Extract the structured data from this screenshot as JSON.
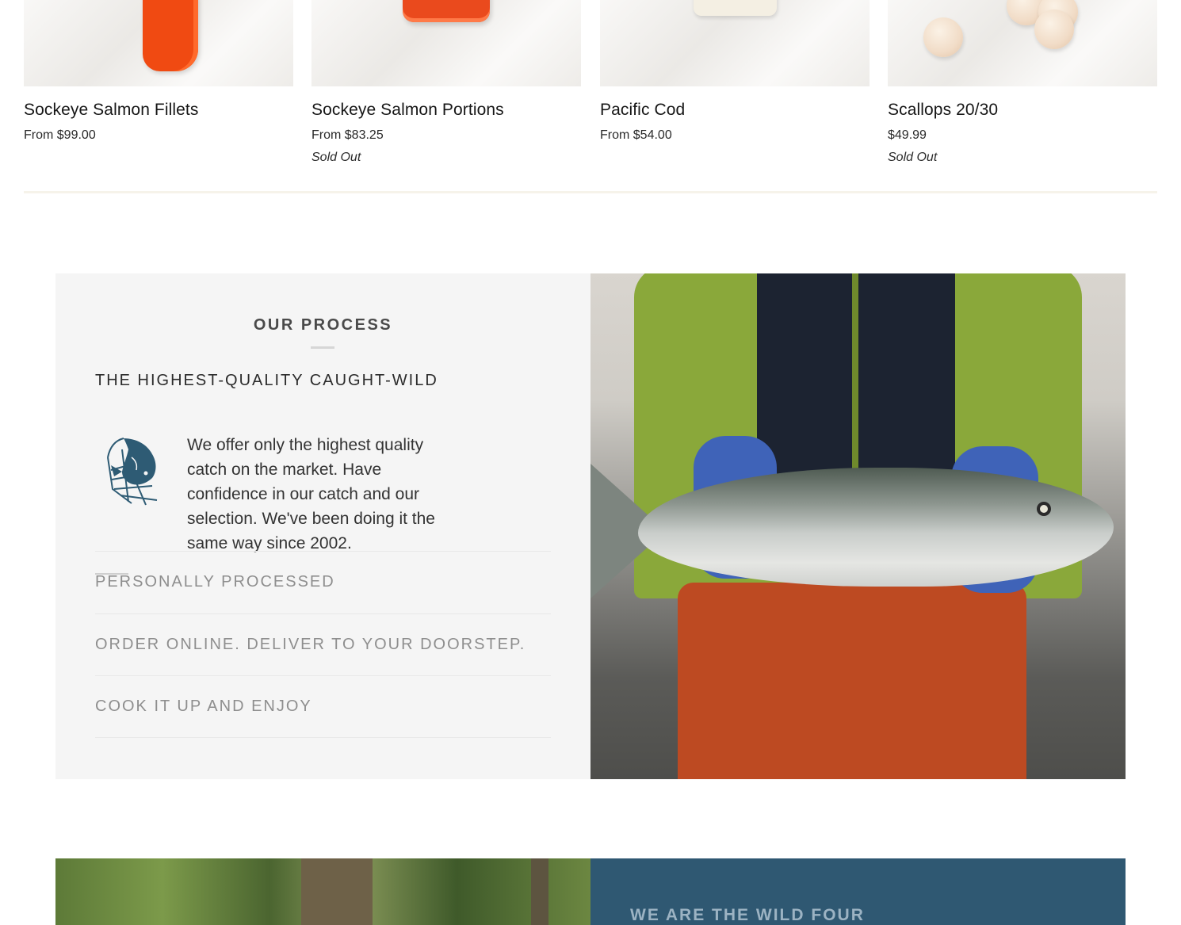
{
  "products": [
    {
      "title": "Sockeye Salmon Fillets",
      "price": "From $99.00",
      "status": ""
    },
    {
      "title": "Sockeye Salmon Portions",
      "price": "From $83.25",
      "status": "Sold Out"
    },
    {
      "title": "Pacific Cod",
      "price": "From $54.00",
      "status": ""
    },
    {
      "title": "Scallops 20/30",
      "price": "$49.99",
      "status": "Sold Out"
    }
  ],
  "process": {
    "heading": "OUR PROCESS",
    "items": [
      {
        "title": "THE HIGHEST-QUALITY CAUGHT-WILD",
        "icon": "fish-net-icon",
        "text": "We offer only the highest quality catch on the market. Have confidence in our catch and our selection. We've been doing it the same way since 2002.",
        "expanded": true
      },
      {
        "title": "PERSONALLY PROCESSED",
        "expanded": false
      },
      {
        "title": "ORDER ONLINE. DELIVER TO YOUR DOORSTEP.",
        "expanded": false
      },
      {
        "title": "COOK IT UP AND ENJOY",
        "expanded": false
      }
    ]
  },
  "wild": {
    "title": "WE ARE THE WILD FOUR"
  },
  "colors": {
    "panel_bg": "#f5f5f5",
    "brand_blue": "#2f5872",
    "icon_blue": "#2e5b74"
  }
}
